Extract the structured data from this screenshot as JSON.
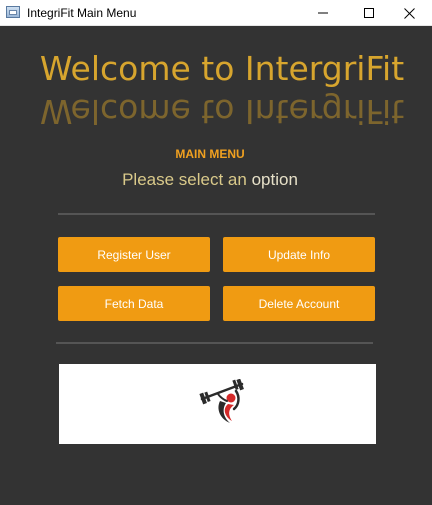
{
  "window": {
    "title": "IntegriFit Main Menu",
    "icons": {
      "app": "app-window-icon",
      "minimize": "minimize-icon",
      "maximize": "maximize-icon",
      "close": "close-icon"
    }
  },
  "main": {
    "welcome": "Welcome to IntergriFit",
    "heading": "MAIN MENU",
    "subtitle_part1": "Please select an",
    "subtitle_part2": "option",
    "buttons": {
      "register": "Register User",
      "update": "Update Info",
      "fetch": "Fetch Data",
      "delete": "Delete Account"
    },
    "logo_icon": "fitness-logo-icon"
  },
  "colors": {
    "background": "#333333",
    "accent": "#f09b12",
    "title_gold": "#d7a52e",
    "logo_red": "#d42a2a",
    "logo_dark": "#2b2b2b"
  }
}
